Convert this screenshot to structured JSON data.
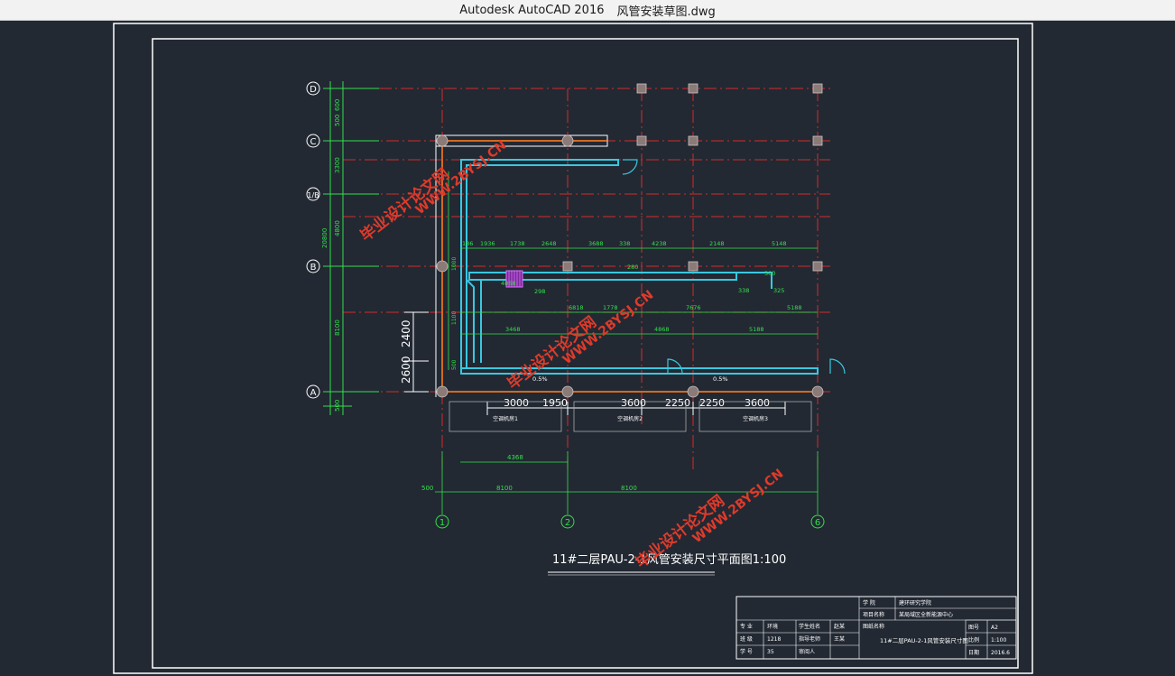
{
  "window": {
    "app_title": "Autodesk AutoCAD 2016",
    "file_name": "风管安装草图.dwg"
  },
  "grid_labels": {
    "rows": [
      "D",
      "C",
      "1/B",
      "B",
      "A"
    ],
    "columns": [
      "1",
      "2",
      "6"
    ]
  },
  "dimensions": {
    "left_vertical": [
      "500",
      "600",
      "3300",
      "4800",
      "20800",
      "8100",
      "500"
    ],
    "left_room": [
      "2400",
      "2600"
    ],
    "bottom_row_large": [
      "3000",
      "1950",
      "3600",
      "2250",
      "2250",
      "3600"
    ],
    "bottom_extra": [
      "4368",
      "500",
      "8100",
      "8100"
    ],
    "top_run": [
      "186",
      "1936",
      "1738",
      "2648",
      "3688",
      "338",
      "4238",
      "2148",
      "5148"
    ],
    "middle_run": [
      "6818",
      "1778",
      "7676",
      "5188"
    ],
    "lower_run": [
      "3468",
      "4868",
      "5188"
    ],
    "duct_sizes": [
      "280",
      "300",
      "325",
      "298",
      "338",
      "4868"
    ],
    "slopes": [
      "0.5%",
      "0.5%"
    ],
    "misc": [
      "1000",
      "500",
      "1100"
    ]
  },
  "room_labels": [
    "空调机房1",
    "空调机房2",
    "空调机房3"
  ],
  "drawing_title": "11#二层PAU-2-1风管安装尺寸平面图1:100",
  "watermarks": [
    {
      "line1": "毕业设计论文网",
      "line2": "WWW.2BYSJ.CN"
    },
    {
      "line1": "毕业设计论文网",
      "line2": "WWW.2BYSJ.CN"
    },
    {
      "line1": "毕业设计论文网",
      "line2": "WWW.2BYSJ.CN"
    }
  ],
  "title_block": {
    "school_label": "学 院",
    "school_value": "建环研究学院",
    "project_label": "项目名称",
    "project_value": "某局域区全新能源中心",
    "drawing_name_label": "图纸名称",
    "drawing_name_value": "11#二层PAU-2-1风管安装尺寸图",
    "major_label": "专 业",
    "major_value": "环境",
    "student_label": "学生姓名",
    "student_value": "赵某",
    "class_label": "班 级",
    "class_value": "1218",
    "teacher_label": "指导老师",
    "teacher_value": "王某",
    "id_label": "学 号",
    "id_value": "35",
    "review_label": "审阅人",
    "sheet_label": "图号",
    "sheet_value": "A2",
    "scale_label": "比例",
    "scale_value": "1:100",
    "date_label": "日期",
    "date_value": "2016.6"
  },
  "colors": {
    "background": "#222933",
    "frame": "#ffffff",
    "axis_red": "#d42a2a",
    "dim_green": "#33e04a",
    "duct_cyan": "#39c8e0",
    "wall_orange": "#d2691e",
    "column_gray": "#8a7a78",
    "watermark_red": "#e03a2a"
  }
}
